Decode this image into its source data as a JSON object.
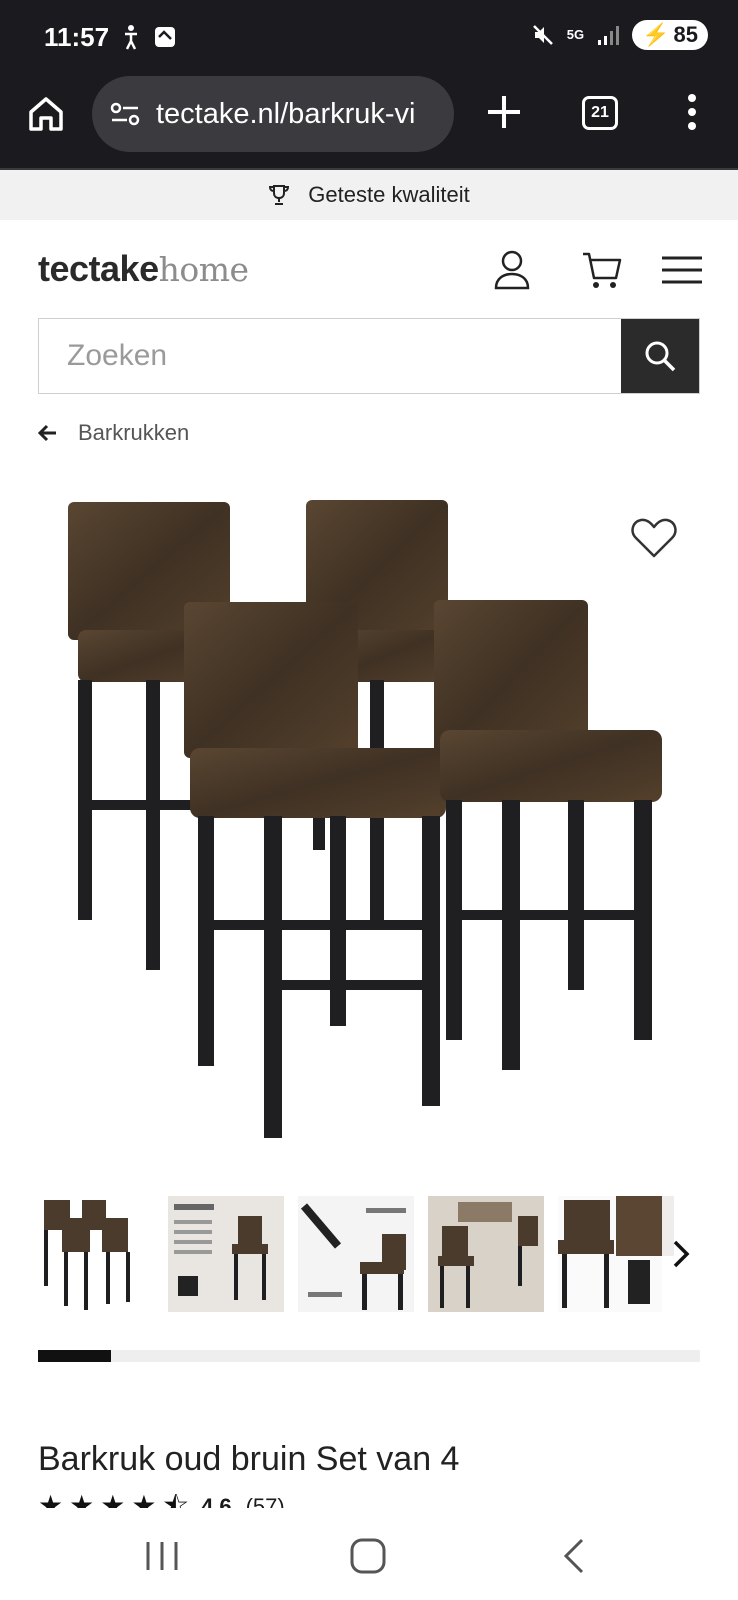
{
  "status": {
    "time": "11:57",
    "battery": "85",
    "network": "5G"
  },
  "browser": {
    "url": "tectake.nl/barkruk-vi",
    "tab_count": "21"
  },
  "promo": {
    "text": "Geteste kwaliteit"
  },
  "logo": {
    "bold": "tectake",
    "light": "home"
  },
  "search": {
    "placeholder": "Zoeken"
  },
  "breadcrumb": {
    "label": "Barkrukken"
  },
  "gallery": {
    "progress_fraction": 0.11
  },
  "product": {
    "title": "Barkruk oud bruin Set van 4",
    "rating": "4.6",
    "reviews": "(57)",
    "stars": 4.5
  },
  "colors": {
    "chrome": "#1b1b1f",
    "leather": "#4a3b2c",
    "legs": "#1f1f22"
  }
}
